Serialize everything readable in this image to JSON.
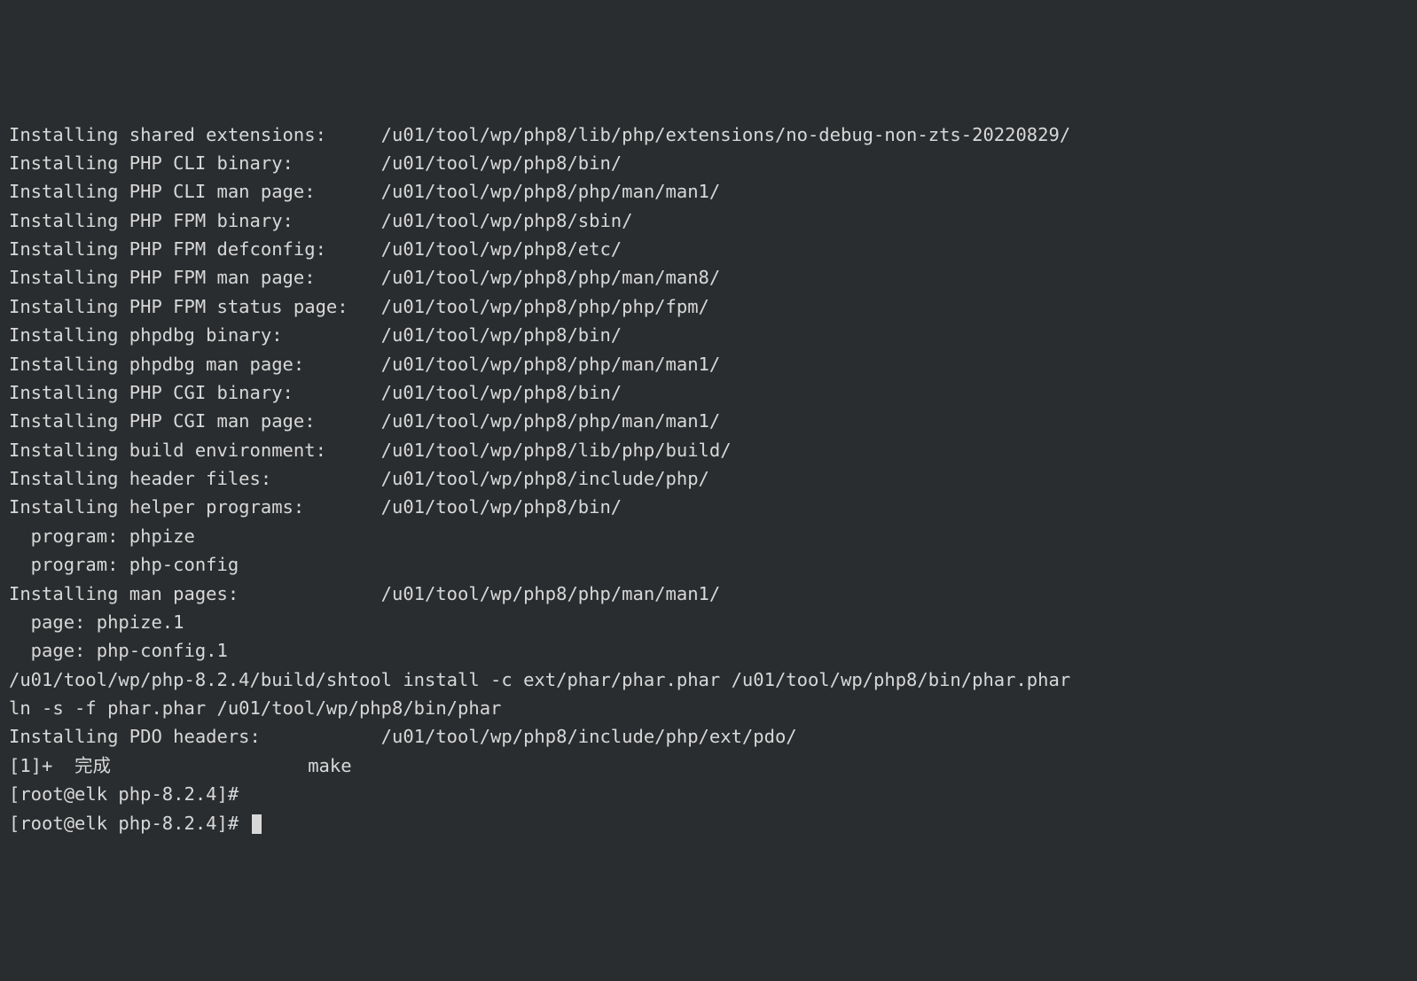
{
  "lines": [
    {
      "label": "Installing shared extensions:     ",
      "path": "/u01/tool/wp/php8/lib/php/extensions/no-debug-non-zts-20220829/"
    },
    {
      "label": "Installing PHP CLI binary:        ",
      "path": "/u01/tool/wp/php8/bin/"
    },
    {
      "label": "Installing PHP CLI man page:      ",
      "path": "/u01/tool/wp/php8/php/man/man1/"
    },
    {
      "label": "Installing PHP FPM binary:        ",
      "path": "/u01/tool/wp/php8/sbin/"
    },
    {
      "label": "Installing PHP FPM defconfig:     ",
      "path": "/u01/tool/wp/php8/etc/"
    },
    {
      "label": "Installing PHP FPM man page:      ",
      "path": "/u01/tool/wp/php8/php/man/man8/"
    },
    {
      "label": "Installing PHP FPM status page:   ",
      "path": "/u01/tool/wp/php8/php/php/fpm/"
    },
    {
      "label": "Installing phpdbg binary:         ",
      "path": "/u01/tool/wp/php8/bin/"
    },
    {
      "label": "Installing phpdbg man page:       ",
      "path": "/u01/tool/wp/php8/php/man/man1/"
    },
    {
      "label": "Installing PHP CGI binary:        ",
      "path": "/u01/tool/wp/php8/bin/"
    },
    {
      "label": "Installing PHP CGI man page:      ",
      "path": "/u01/tool/wp/php8/php/man/man1/"
    },
    {
      "label": "Installing build environment:     ",
      "path": "/u01/tool/wp/php8/lib/php/build/"
    },
    {
      "label": "Installing header files:          ",
      "path": "/u01/tool/wp/php8/include/php/"
    },
    {
      "label": "Installing helper programs:       ",
      "path": "/u01/tool/wp/php8/bin/"
    }
  ],
  "helper_programs": [
    "  program: phpize",
    "  program: php-config"
  ],
  "man_pages_line": {
    "label": "Installing man pages:             ",
    "path": "/u01/tool/wp/php8/php/man/man1/"
  },
  "man_pages": [
    "  page: phpize.1",
    "  page: php-config.1"
  ],
  "shtool_line": "/u01/tool/wp/php-8.2.4/build/shtool install -c ext/phar/phar.phar /u01/tool/wp/php8/bin/phar.phar",
  "ln_line": "ln -s -f phar.phar /u01/tool/wp/php8/bin/phar",
  "pdo_line": {
    "label": "Installing PDO headers:           ",
    "path": "/u01/tool/wp/php8/include/php/ext/pdo/"
  },
  "job_done_line": "[1]+  完成                  make",
  "prompt1": "[root@elk php-8.2.4]#",
  "prompt2": "[root@elk php-8.2.4]# "
}
